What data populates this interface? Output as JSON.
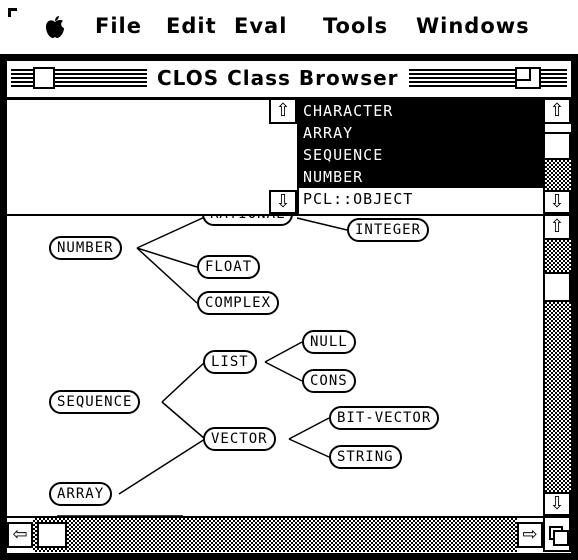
{
  "menubar": {
    "apple_icon": "apple-icon",
    "items": [
      "File",
      "Edit",
      "Eval",
      "Tools",
      "Windows"
    ]
  },
  "window": {
    "title": "CLOS Class Browser",
    "selector": {
      "selected_items": [
        "CHARACTER",
        "ARRAY",
        "SEQUENCE",
        "NUMBER"
      ],
      "other_items": [
        "PCL::OBJECT"
      ]
    },
    "graph": {
      "nodes": {
        "partial_top": "RATIONAL",
        "integer": "INTEGER",
        "number": "NUMBER",
        "float": "FLOAT",
        "complex": "COMPLEX",
        "null": "NULL",
        "list": "LIST",
        "cons": "CONS",
        "sequence": "SEQUENCE",
        "bit_vector": "BIT-VECTOR",
        "vector": "VECTOR",
        "string": "STRING",
        "array": "ARRAY"
      }
    }
  }
}
